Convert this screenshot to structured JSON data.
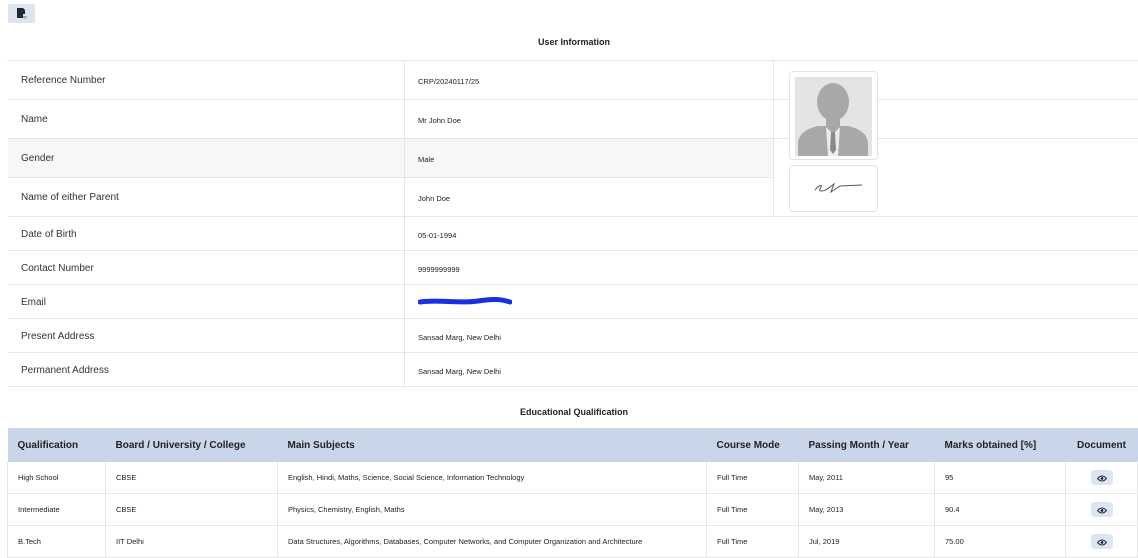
{
  "toolbar": {
    "pdf_icon": "pdf-export-icon"
  },
  "user_info": {
    "title": "User Information",
    "rows": [
      {
        "label": "Reference Number",
        "value": "CRP/20240117/25"
      },
      {
        "label": "Name",
        "value": "Mr John Doe"
      },
      {
        "label": "Gender",
        "value": "Male"
      },
      {
        "label": "Name of either Parent",
        "value": "John Doe"
      },
      {
        "label": "Date of Birth",
        "value": "05-01-1994"
      },
      {
        "label": "Contact Number",
        "value": "9999999999"
      },
      {
        "label": "Email",
        "value": ""
      },
      {
        "label": "Present Address",
        "value": "Sansad Marg, New Delhi"
      },
      {
        "label": "Permanent Address",
        "value": "Sansad Marg, New Delhi"
      }
    ],
    "photo_icon": "user-photo-placeholder",
    "signature_icon": "signature-image",
    "redaction_color": "#1a2fe0"
  },
  "education": {
    "title": "Educational Qualification",
    "headers": [
      "Qualification",
      "Board / University / College",
      "Main Subjects",
      "Course Mode",
      "Passing Month / Year",
      "Marks obtained [%]",
      "Document"
    ],
    "rows": [
      {
        "qualification": "High School",
        "board": "CBSE",
        "subjects": "English, Hindi, Maths, Science, Social Science, Information Technology",
        "mode": "Full Time",
        "passing": "May, 2011",
        "marks": "95"
      },
      {
        "qualification": "Intermediate",
        "board": "CBSE",
        "subjects": "Physics, Chemistry, English, Maths",
        "mode": "Full Time",
        "passing": "May, 2013",
        "marks": "90.4"
      },
      {
        "qualification": "B.Tech",
        "board": "IIT Delhi",
        "subjects": "Data Structures, Algorithms, Databases, Computer Networks, and Computer Organization and Architecture",
        "mode": "Full Time",
        "passing": "Jul, 2019",
        "marks": "75.00"
      }
    ],
    "header_bg": "#c9d6ea"
  }
}
